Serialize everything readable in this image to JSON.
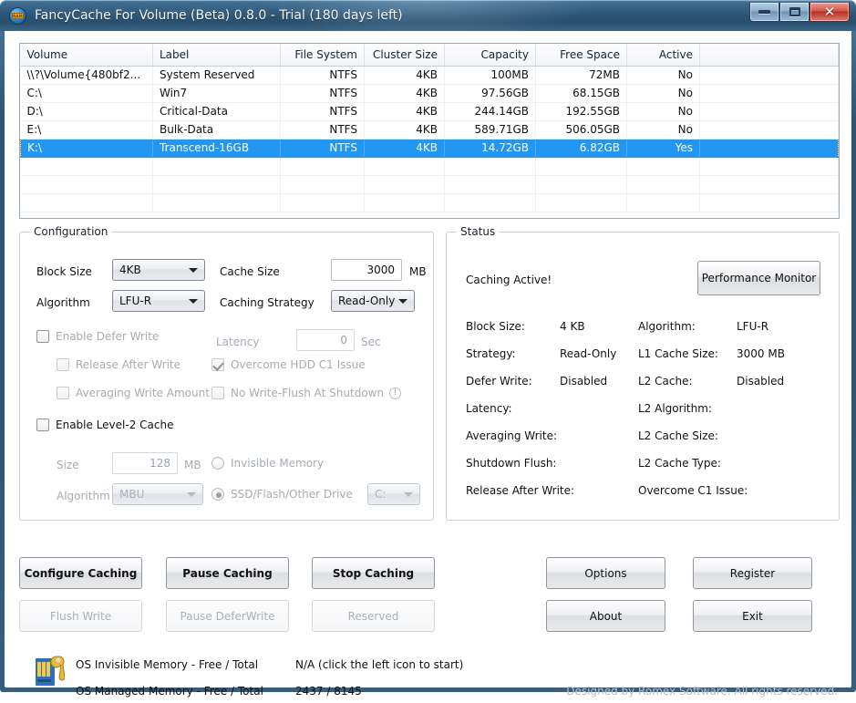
{
  "window": {
    "title": "FancyCache For Volume (Beta) 0.8.0 - Trial (180 days left)",
    "app_icon": "ram-chip-icon",
    "chip_text": "RAM",
    "minimize_label": "–",
    "maximize_label": "□",
    "close_label": "✕",
    "accent_selection": "#2196f3",
    "titlebar_color": "#2d5472"
  },
  "volume_table": {
    "columns": [
      "Volume",
      "Label",
      "File System",
      "Cluster Size",
      "Capacity",
      "Free Space",
      "Active"
    ],
    "rows": [
      {
        "volume": "\\\\?\\Volume{480bf2...",
        "label": "System Reserved",
        "fs": "NTFS",
        "cluster": "4KB",
        "capacity": "100MB",
        "free": "72MB",
        "active": "No",
        "selected": false
      },
      {
        "volume": "C:\\",
        "label": "Win7",
        "fs": "NTFS",
        "cluster": "4KB",
        "capacity": "97.56GB",
        "free": "68.15GB",
        "active": "No",
        "selected": false
      },
      {
        "volume": "D:\\",
        "label": "Critical-Data",
        "fs": "NTFS",
        "cluster": "4KB",
        "capacity": "244.14GB",
        "free": "192.55GB",
        "active": "No",
        "selected": false
      },
      {
        "volume": "E:\\",
        "label": "Bulk-Data",
        "fs": "NTFS",
        "cluster": "4KB",
        "capacity": "589.71GB",
        "free": "506.05GB",
        "active": "No",
        "selected": false
      },
      {
        "volume": "K:\\",
        "label": "Transcend-16GB",
        "fs": "NTFS",
        "cluster": "4KB",
        "capacity": "14.72GB",
        "free": "6.82GB",
        "active": "Yes",
        "selected": true
      }
    ],
    "empty_row_count": 3
  },
  "configuration": {
    "legend": "Configuration",
    "block_size_label": "Block Size",
    "block_size_value": "4KB",
    "cache_size_label": "Cache Size",
    "cache_size_value": "3000",
    "cache_size_unit": "MB",
    "algorithm_label": "Algorithm",
    "algorithm_value": "LFU-R",
    "caching_strategy_label": "Caching Strategy",
    "caching_strategy_value": "Read-Only",
    "enable_defer_write_label": "Enable Defer Write",
    "enable_defer_write_checked": false,
    "latency_label": "Latency",
    "latency_value": "0",
    "latency_unit": "Sec",
    "release_after_write_label": "Release After Write",
    "release_after_write_checked": false,
    "overcome_hdd_c1_label": "Overcome HDD C1 Issue",
    "overcome_hdd_c1_checked": true,
    "averaging_write_label": "Averaging Write Amount",
    "averaging_write_checked": false,
    "no_write_flush_label": "No Write-Flush At Shutdown",
    "no_write_flush_checked": false,
    "no_write_flush_warning": "!",
    "enable_l2_label": "Enable Level-2 Cache",
    "enable_l2_checked": false,
    "l2_size_label": "Size",
    "l2_size_value": "128",
    "l2_size_unit": "MB",
    "l2_algorithm_label": "Algorithm",
    "l2_algorithm_value": "MBU",
    "invisible_memory_label": "Invisible Memory",
    "invisible_memory_selected": false,
    "ssd_drive_label": "SSD/Flash/Other Drive",
    "ssd_drive_selected": true,
    "ssd_drive_value": "C:"
  },
  "status": {
    "legend": "Status",
    "caching_state": "Caching Active!",
    "performance_monitor_label": "Performance Monitor",
    "left_rows": [
      {
        "label": "Block Size:",
        "value": "4 KB"
      },
      {
        "label": "Strategy:",
        "value": "Read-Only"
      },
      {
        "label": "Defer Write:",
        "value": "Disabled"
      },
      {
        "label": "Latency:",
        "value": ""
      },
      {
        "label": "Averaging Write:",
        "value": ""
      },
      {
        "label": "Shutdown Flush:",
        "value": ""
      },
      {
        "label": "Release After Write:",
        "value": ""
      }
    ],
    "right_rows": [
      {
        "label": "Algorithm:",
        "value": "LFU-R"
      },
      {
        "label": "L1 Cache Size:",
        "value": "3000 MB"
      },
      {
        "label": "L2 Cache:",
        "value": "Disabled"
      },
      {
        "label": "L2 Algorithm:",
        "value": ""
      },
      {
        "label": "L2 Cache Size:",
        "value": ""
      },
      {
        "label": "L2 Cache Type:",
        "value": ""
      },
      {
        "label": "Overcome C1 Issue:",
        "value": ""
      }
    ]
  },
  "buttons": {
    "configure_caching": "Configure Caching",
    "pause_caching": "Pause Caching",
    "stop_caching": "Stop Caching",
    "flush_write": "Flush Write",
    "pause_deferwrite": "Pause DeferWrite",
    "reserved": "Reserved",
    "options": "Options",
    "register": "Register",
    "about": "About",
    "exit": "Exit"
  },
  "footer": {
    "icon": "memory-wrench-icon",
    "invisible_memory_label": "OS Invisible Memory - Free / Total",
    "invisible_memory_value": "N/A (click the left icon to start)",
    "managed_memory_label": "OS Managed Memory - Free / Total",
    "managed_memory_value": "2437 / 8145",
    "copyright": "Designed by Romex Software. All rights reserved."
  }
}
